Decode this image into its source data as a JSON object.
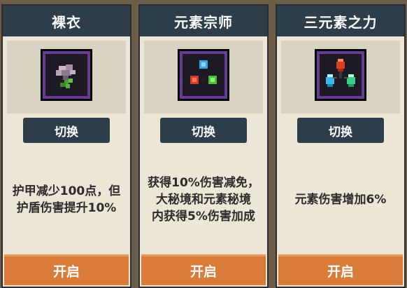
{
  "cards": [
    {
      "title": "裸衣",
      "icon": "flower-bouquet-icon",
      "switch_label": "切换",
      "description_lines": [
        "护甲减少100点，但",
        "护盾伤害提升10%"
      ],
      "open_label": "开启"
    },
    {
      "title": "元素宗师",
      "icon": "element-gems-icon",
      "switch_label": "切换",
      "description_lines": [
        "获得10%伤害减免，",
        "大秘境和元素秘境",
        "内获得5%伤害加成"
      ],
      "open_label": "开启"
    },
    {
      "title": "三元素之力",
      "icon": "three-crystals-icon",
      "switch_label": "切换",
      "description_lines": [
        "元素伤害增加6%"
      ],
      "open_label": "开启"
    }
  ],
  "colors": {
    "header_bg": "#2d3d4a",
    "card_bg": "#ece6d6",
    "open_button": "#d97c3a",
    "icon_border": "#6a3a98"
  }
}
